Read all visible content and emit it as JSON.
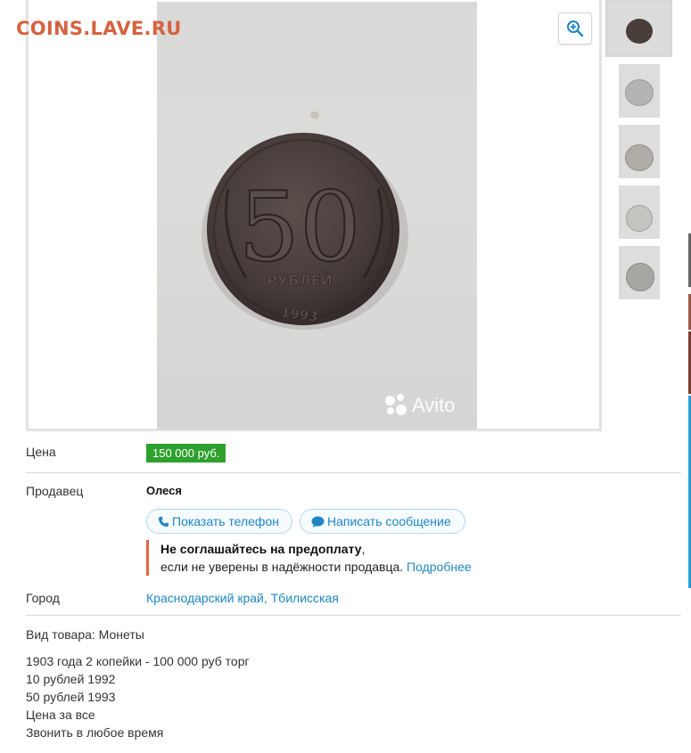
{
  "watermark": "COINS.LAVE.RU",
  "photo_brand": "Avito",
  "icons": {
    "zoom": "zoom-in-icon",
    "phone": "phone-icon",
    "message": "chat-bubble-icon"
  },
  "colors": {
    "price_bg": "#2ea02d",
    "link": "#1e87c4",
    "warning_bar": "#e2673d",
    "watermark": "#d6623f"
  },
  "price": {
    "label": "Цена",
    "value": "150 000 руб."
  },
  "seller": {
    "label": "Продавец",
    "name": "Олеся",
    "show_phone": "Показать телефон",
    "write_message": "Написать сообщение"
  },
  "warning": {
    "bold": "Не соглашайтесь на предоплату",
    "comma": ",",
    "text": "если не уверены в надёжности продавца.",
    "link": "Подробнее"
  },
  "city": {
    "label": "Город",
    "value": "Краснодарский край, Тбилисская"
  },
  "description": {
    "type": "Вид товара: Монеты",
    "lines": [
      "1903 года 2 копейки - 100 000 руб торг",
      "10 рублей 1992",
      "50 рублей 1993",
      "Цена за все",
      "Звонить в любое время"
    ]
  }
}
